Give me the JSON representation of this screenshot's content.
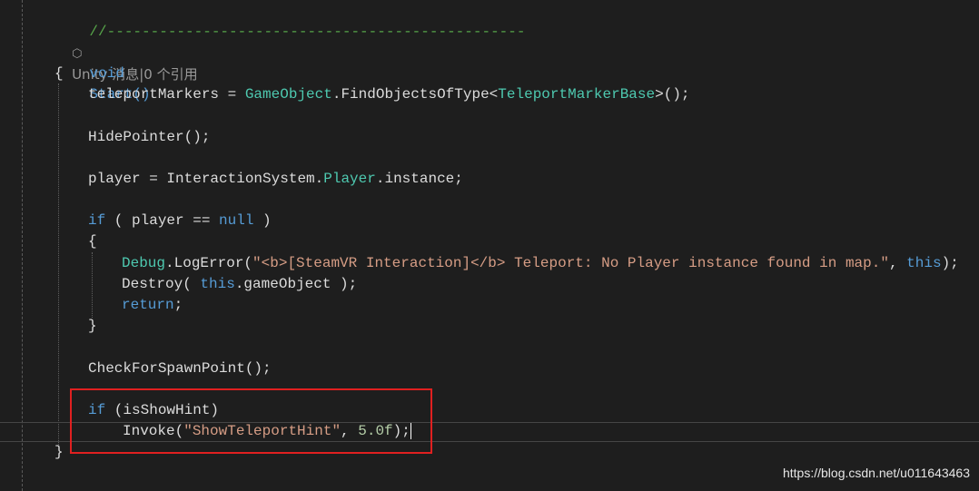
{
  "editor": {
    "codelens": {
      "prefix": "Unity 消息|0 个引用",
      "icon": "unity-cube-icon"
    },
    "lines": {
      "divider": "//------------------------------------------------",
      "signature": {
        "kw": "void",
        "name": "Start()"
      },
      "brace_open": "{",
      "brace_close": "}",
      "l1": {
        "a": "teleportMarkers = ",
        "b": "GameObject",
        "c": ".FindObjectsOfType<",
        "d": "TeleportMarkerBase",
        "e": ">();"
      },
      "l2": "HidePointer();",
      "l3": {
        "a": "player = InteractionSystem.",
        "b": "Player",
        "c": ".instance;"
      },
      "l4": {
        "a": "if",
        "b": " ( player == ",
        "c": "null",
        "d": " )"
      },
      "l5": "{",
      "l6": {
        "a": "Debug",
        "b": ".LogError(",
        "c": "\"<b>[SteamVR Interaction]</b> Teleport: No Player instance found in map.\"",
        "d": ", ",
        "e": "this",
        "f": ");"
      },
      "l7": {
        "a": "Destroy( ",
        "b": "this",
        "c": ".gameObject );"
      },
      "l8": {
        "a": "return",
        "b": ";"
      },
      "l9": "}",
      "l10": "CheckForSpawnPoint();",
      "l11": {
        "a": "if",
        "b": " (isShowHint)"
      },
      "l12": {
        "a": "Invoke(",
        "b": "\"ShowTeleportHint\"",
        "c": ", ",
        "d": "5.0f",
        "e": ");"
      }
    }
  },
  "watermark": "https://blog.csdn.net/u011643463",
  "colors": {
    "background": "#1e1e1e",
    "keyword": "#569cd6",
    "type": "#4ec9b0",
    "string": "#d69d85",
    "number": "#b5cea8",
    "comment": "#57a64a",
    "highlight_box": "#e02020"
  }
}
